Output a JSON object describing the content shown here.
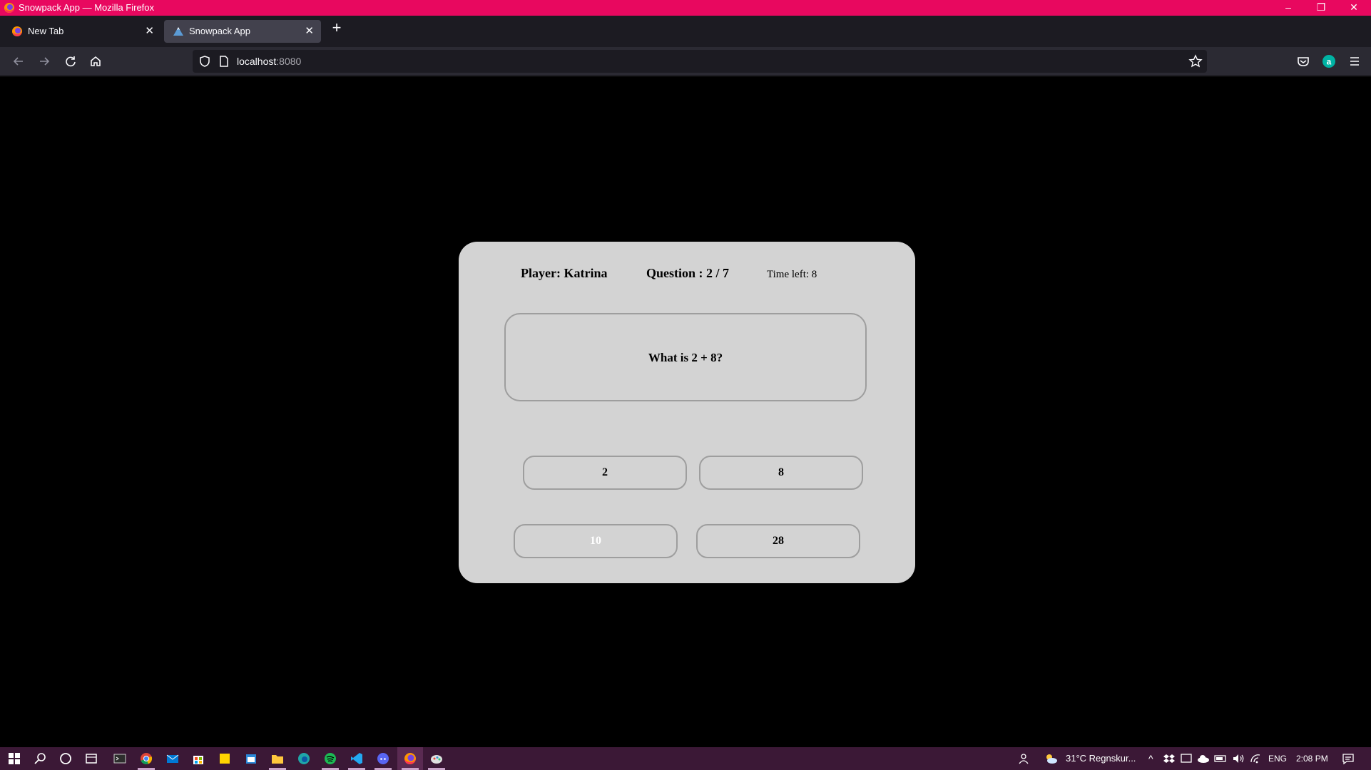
{
  "window": {
    "title": "Snowpack App — Mozilla Firefox",
    "minimize": "–",
    "restore": "❐",
    "close": "✕"
  },
  "tabs": [
    {
      "label": "New Tab",
      "close": "✕"
    },
    {
      "label": "Snowpack App",
      "close": "✕"
    }
  ],
  "new_tab": "+",
  "url": {
    "host": "localhost",
    "port": ":8080"
  },
  "quiz": {
    "player": "Player: Katrina",
    "question_counter": "Question : 2 / 7",
    "time_left": "Time left: 8",
    "question": "What is 2 + 8?",
    "answers": [
      "2",
      "8",
      "10",
      "28"
    ]
  },
  "taskbar": {
    "weather": "31°C  Regnskur...",
    "language": "ENG",
    "time": "2:08 PM"
  },
  "colors": {
    "titlebar": "#e8085f",
    "card": "#d3d3d3",
    "taskbar": "#3b1836"
  }
}
